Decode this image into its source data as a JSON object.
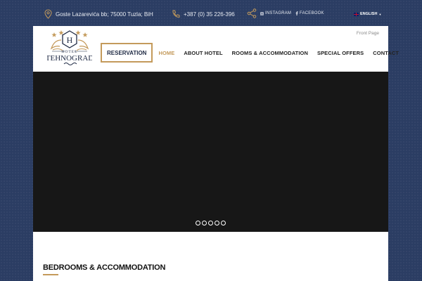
{
  "topbar": {
    "address": "Goste Lazarevića bb; 75000 Tuzla; BiH",
    "phone": "+387 (0) 35 226-396",
    "social": [
      {
        "label": "INSTAGRAM",
        "icon": "instagram-icon"
      },
      {
        "label": "FACEBOOK",
        "icon": "facebook-icon"
      }
    ],
    "language": "ENGLISH"
  },
  "header": {
    "logo": {
      "top": "HOTEL",
      "name": "TEHNOGRAD",
      "letter": "H"
    },
    "front_page": "Front Page",
    "reservation_label": "RESERVATION",
    "nav": [
      {
        "label": "HOME",
        "active": true
      },
      {
        "label": "ABOUT HOTEL",
        "active": false
      },
      {
        "label": "ROOMS & ACCOMMODATION",
        "active": false
      },
      {
        "label": "SPECIAL OFFERS",
        "active": false
      },
      {
        "label": "CONTACT",
        "active": false
      }
    ]
  },
  "slider": {
    "slide_count": 5
  },
  "section": {
    "title": "BEDROOMS & ACCOMMODATION"
  },
  "colors": {
    "accent": "#c49a5b",
    "background": "#2b3d63",
    "slider": "#171717"
  }
}
